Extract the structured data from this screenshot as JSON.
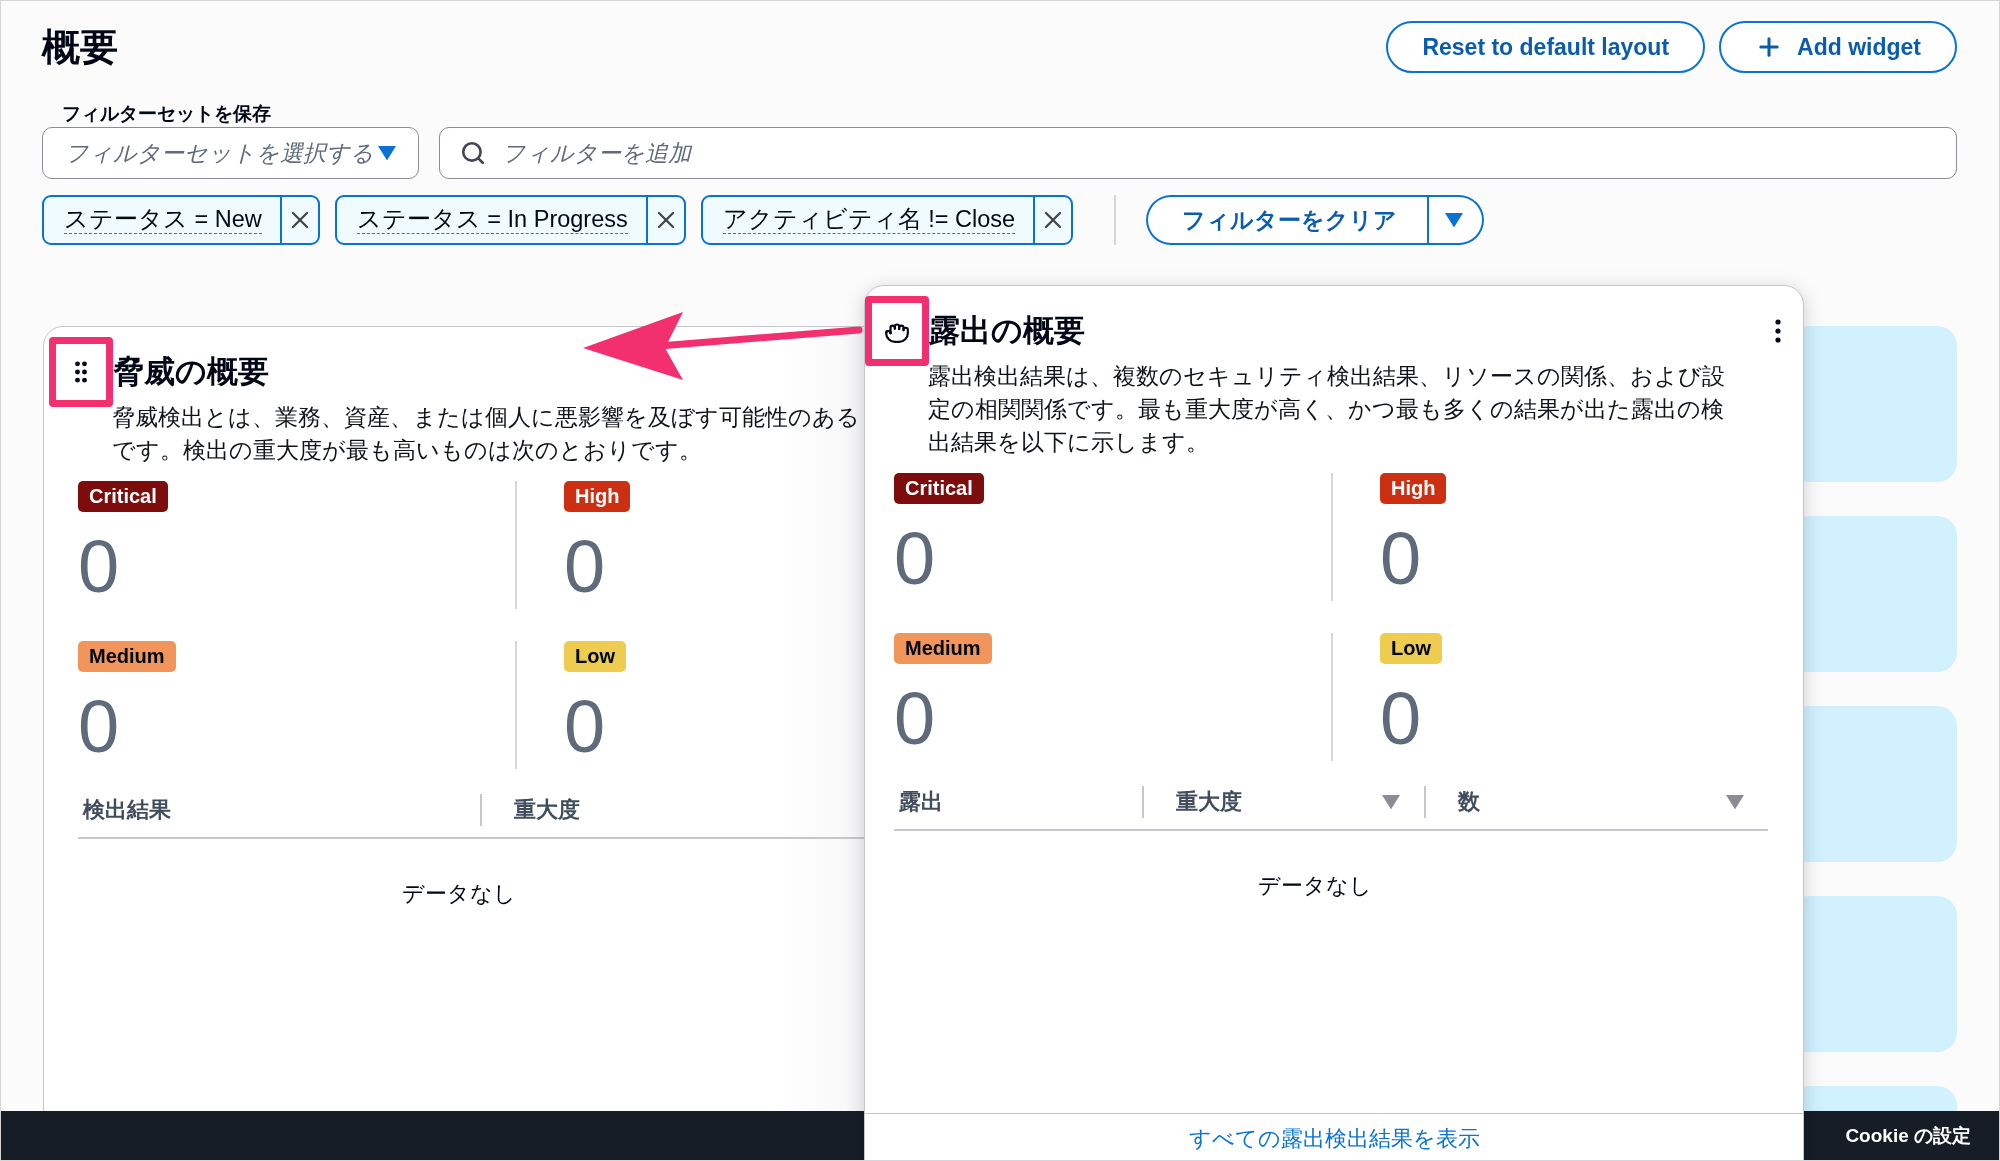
{
  "page_title": "概要",
  "header_buttons": [
    {
      "label": "Reset to default layout",
      "kind": "plain"
    },
    {
      "label": "Add widget",
      "kind": "add"
    }
  ],
  "filter_set": {
    "label": "フィルターセットを保存",
    "placeholder": "フィルターセットを選択する"
  },
  "search": {
    "placeholder": "フィルターを追加"
  },
  "filter_tokens": [
    {
      "label": "ステータス = New"
    },
    {
      "label": "ステータス = In Progress"
    },
    {
      "label": "アクティビティ名 != Close"
    }
  ],
  "clear_filters": {
    "label": "フィルターをクリア"
  },
  "widgets": [
    {
      "title": "脅威の概要",
      "dragging": false,
      "description_lines": [
        "脅威検出とは、業務、資産、または個人に悪影響を及ぼす可能性のある",
        "です。検出の重大度が最も高いものは次のとおりです。"
      ],
      "severities": [
        {
          "label": "Critical",
          "count": "0",
          "color": "#7d0c0c"
        },
        {
          "label": "High",
          "count": "0",
          "color": "#cc2f12"
        },
        {
          "label": "Medium",
          "count": "0",
          "color": "#f2955a"
        },
        {
          "label": "Low",
          "count": "0",
          "color": "#edcc50"
        }
      ],
      "columns": [
        {
          "label": "検出結果",
          "sortable": false
        },
        {
          "label": "重大度",
          "sortable": false
        }
      ],
      "empty_text": "データなし"
    },
    {
      "title": "露出の概要",
      "dragging": true,
      "description_lines": [
        "露出検出結果は、複数のセキュリティ検出結果、リソースの関係、および設",
        "定の相関関係です。最も重大度が高く、かつ最も多くの結果が出た露出の検",
        "出結果を以下に示します。"
      ],
      "severities": [
        {
          "label": "Critical",
          "count": "0",
          "color": "#7d0c0c"
        },
        {
          "label": "High",
          "count": "0",
          "color": "#cc2f12"
        },
        {
          "label": "Medium",
          "count": "0",
          "color": "#f2955a"
        },
        {
          "label": "Low",
          "count": "0",
          "color": "#edcc50"
        }
      ],
      "columns": [
        {
          "label": "露出",
          "sortable": false
        },
        {
          "label": "重大度",
          "sortable": true
        },
        {
          "label": "数",
          "sortable": true
        }
      ],
      "empty_text": "データなし",
      "footer_link": "すべての露出検出結果を表示"
    }
  ],
  "cookie_link": "Cookie の設定"
}
